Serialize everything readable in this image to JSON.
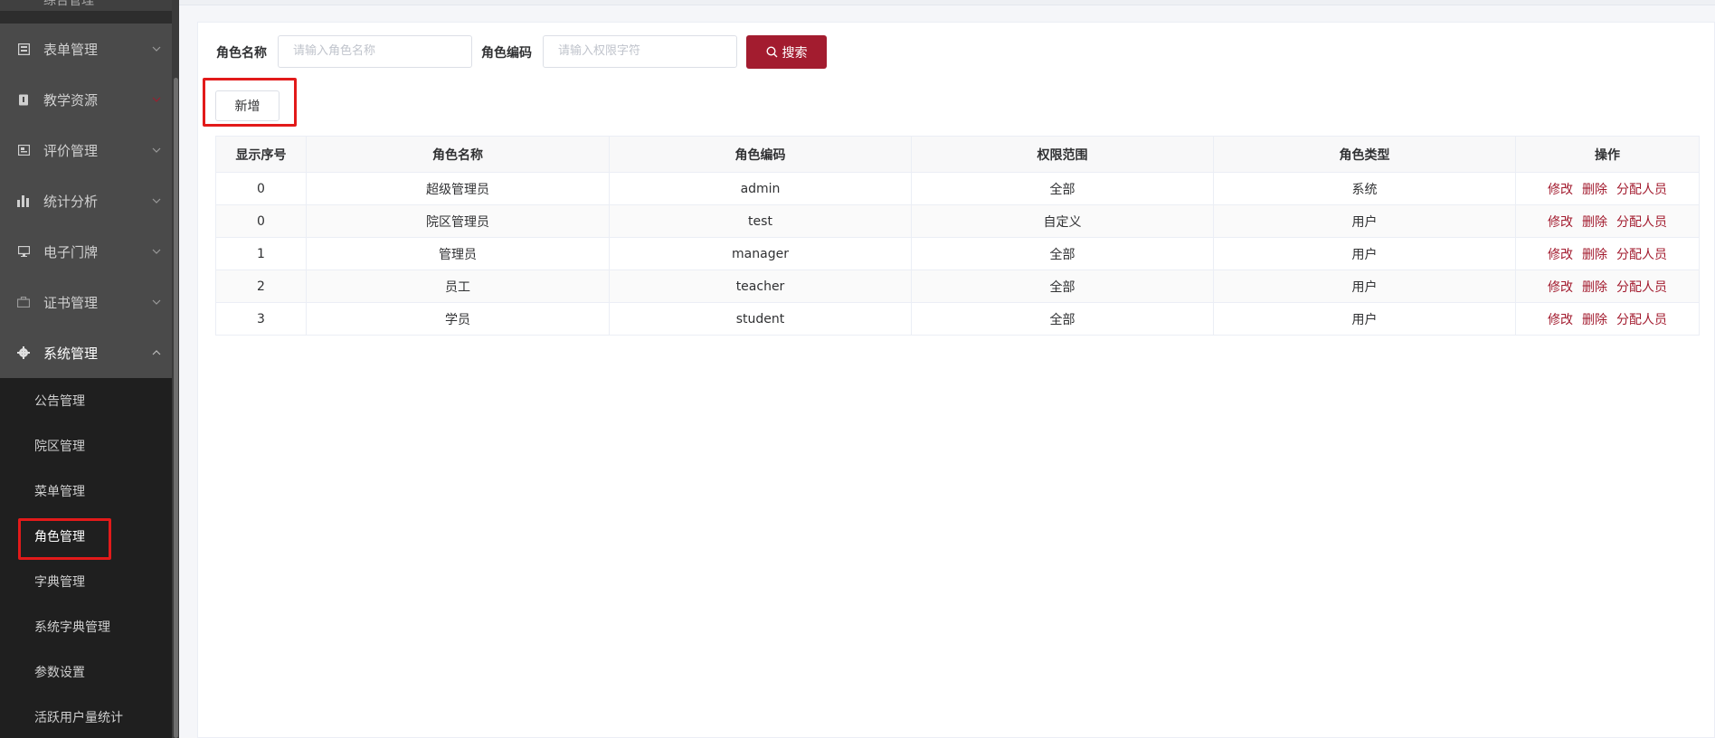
{
  "sidebar": {
    "top_partial_label": "综合管理",
    "menu": [
      {
        "label": "表单管理",
        "icon": "form-icon"
      },
      {
        "label": "教学资源",
        "icon": "resource-icon"
      },
      {
        "label": "评价管理",
        "icon": "evaluation-icon"
      },
      {
        "label": "统计分析",
        "icon": "bar-chart-icon"
      },
      {
        "label": "电子门牌",
        "icon": "monitor-icon"
      },
      {
        "label": "证书管理",
        "icon": "briefcase-icon"
      },
      {
        "label": "系统管理",
        "icon": "gear-icon"
      }
    ],
    "submenu": [
      {
        "label": "公告管理"
      },
      {
        "label": "院区管理"
      },
      {
        "label": "菜单管理"
      },
      {
        "label": "角色管理"
      },
      {
        "label": "字典管理"
      },
      {
        "label": "系统字典管理"
      },
      {
        "label": "参数设置"
      },
      {
        "label": "活跃用户量统计"
      }
    ]
  },
  "search": {
    "role_name_label": "角色名称",
    "role_name_placeholder": "请输入角色名称",
    "role_code_label": "角色编码",
    "role_code_placeholder": "请输入权限字符",
    "search_button": "搜索"
  },
  "toolbar": {
    "add_button": "新增"
  },
  "table": {
    "headers": [
      "显示序号",
      "角色名称",
      "角色编码",
      "权限范围",
      "角色类型",
      "操作"
    ],
    "rows": [
      {
        "order": "0",
        "name": "超级管理员",
        "code": "admin",
        "scope": "全部",
        "type": "系统"
      },
      {
        "order": "0",
        "name": "院区管理员",
        "code": "test",
        "scope": "自定义",
        "type": "用户"
      },
      {
        "order": "1",
        "name": "管理员",
        "code": "manager",
        "scope": "全部",
        "type": "用户"
      },
      {
        "order": "2",
        "name": "员工",
        "code": "teacher",
        "scope": "全部",
        "type": "用户"
      },
      {
        "order": "3",
        "name": "学员",
        "code": "student",
        "scope": "全部",
        "type": "用户"
      }
    ],
    "actions": {
      "edit": "修改",
      "delete": "删除",
      "assign": "分配人员"
    }
  },
  "colors": {
    "primary": "#a31c2f",
    "sidebar_bg": "#2d2d2d",
    "menu_bg": "#4a4a4a",
    "submenu_bg": "#1f1f1f",
    "highlight": "#e21a1a"
  }
}
